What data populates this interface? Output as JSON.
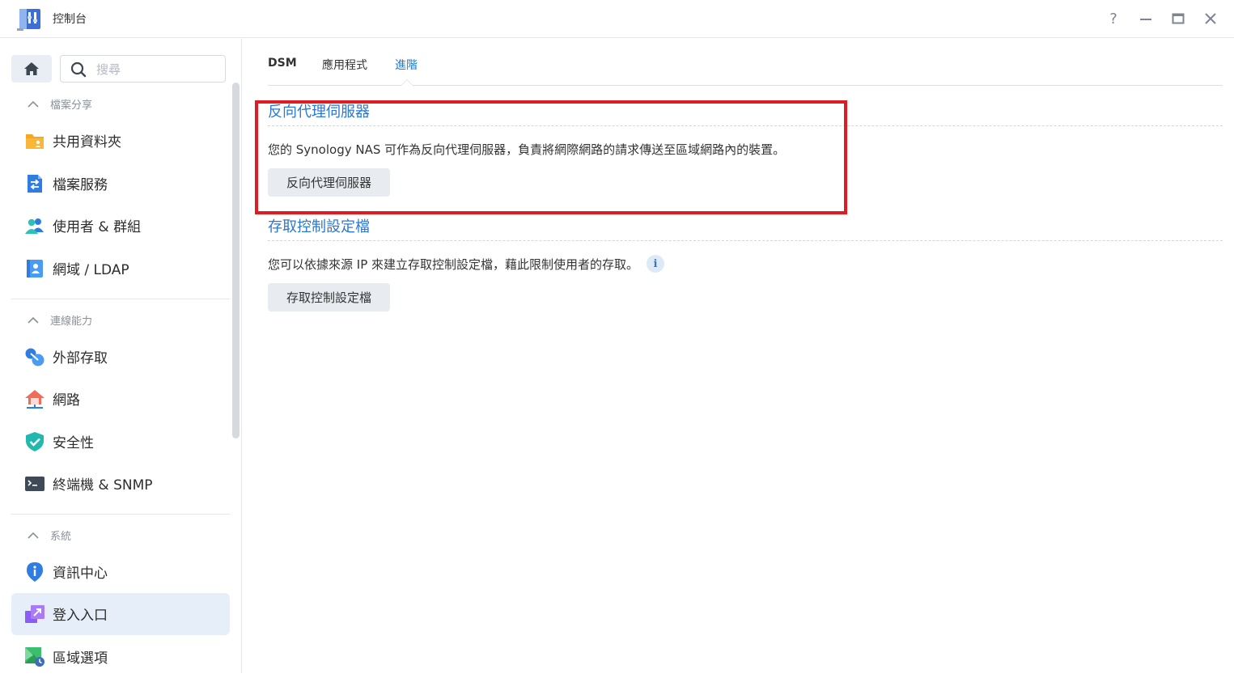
{
  "window": {
    "title": "控制台",
    "help": "?"
  },
  "sidebar": {
    "search_placeholder": "搜尋",
    "sections": [
      {
        "label": "檔案分享",
        "items": [
          {
            "label": "共用資料夾",
            "icon": "shared-folder-icon"
          },
          {
            "label": "檔案服務",
            "icon": "file-services-icon"
          },
          {
            "label": "使用者 & 群組",
            "icon": "user-group-icon"
          },
          {
            "label": "網域 / LDAP",
            "icon": "domain-ldap-icon"
          }
        ]
      },
      {
        "label": "連線能力",
        "items": [
          {
            "label": "外部存取",
            "icon": "external-access-icon"
          },
          {
            "label": "網路",
            "icon": "network-icon"
          },
          {
            "label": "安全性",
            "icon": "security-icon"
          },
          {
            "label": "終端機 & SNMP",
            "icon": "terminal-icon"
          }
        ]
      },
      {
        "label": "系統",
        "items": [
          {
            "label": "資訊中心",
            "icon": "info-center-icon"
          },
          {
            "label": "登入入口",
            "icon": "login-portal-icon",
            "active": true
          },
          {
            "label": "區域選項",
            "icon": "regional-options-icon"
          }
        ]
      }
    ]
  },
  "tabs": [
    {
      "label": "DSM"
    },
    {
      "label": "應用程式"
    },
    {
      "label": "進階",
      "active": true
    }
  ],
  "main": {
    "reverse_proxy": {
      "title": "反向代理伺服器",
      "description": "您的 Synology NAS 可作為反向代理伺服器，負責將網際網路的請求傳送至區域網路內的裝置。",
      "button": "反向代理伺服器"
    },
    "access_control": {
      "title": "存取控制設定檔",
      "description": "您可以依據來源 IP 來建立存取控制設定檔，藉此限制使用者的存取。",
      "info": "i",
      "button": "存取控制設定檔"
    }
  },
  "colors": {
    "accent": "#2b78d0",
    "highlight": "#e11b22",
    "active_bg": "#e6eef9"
  }
}
